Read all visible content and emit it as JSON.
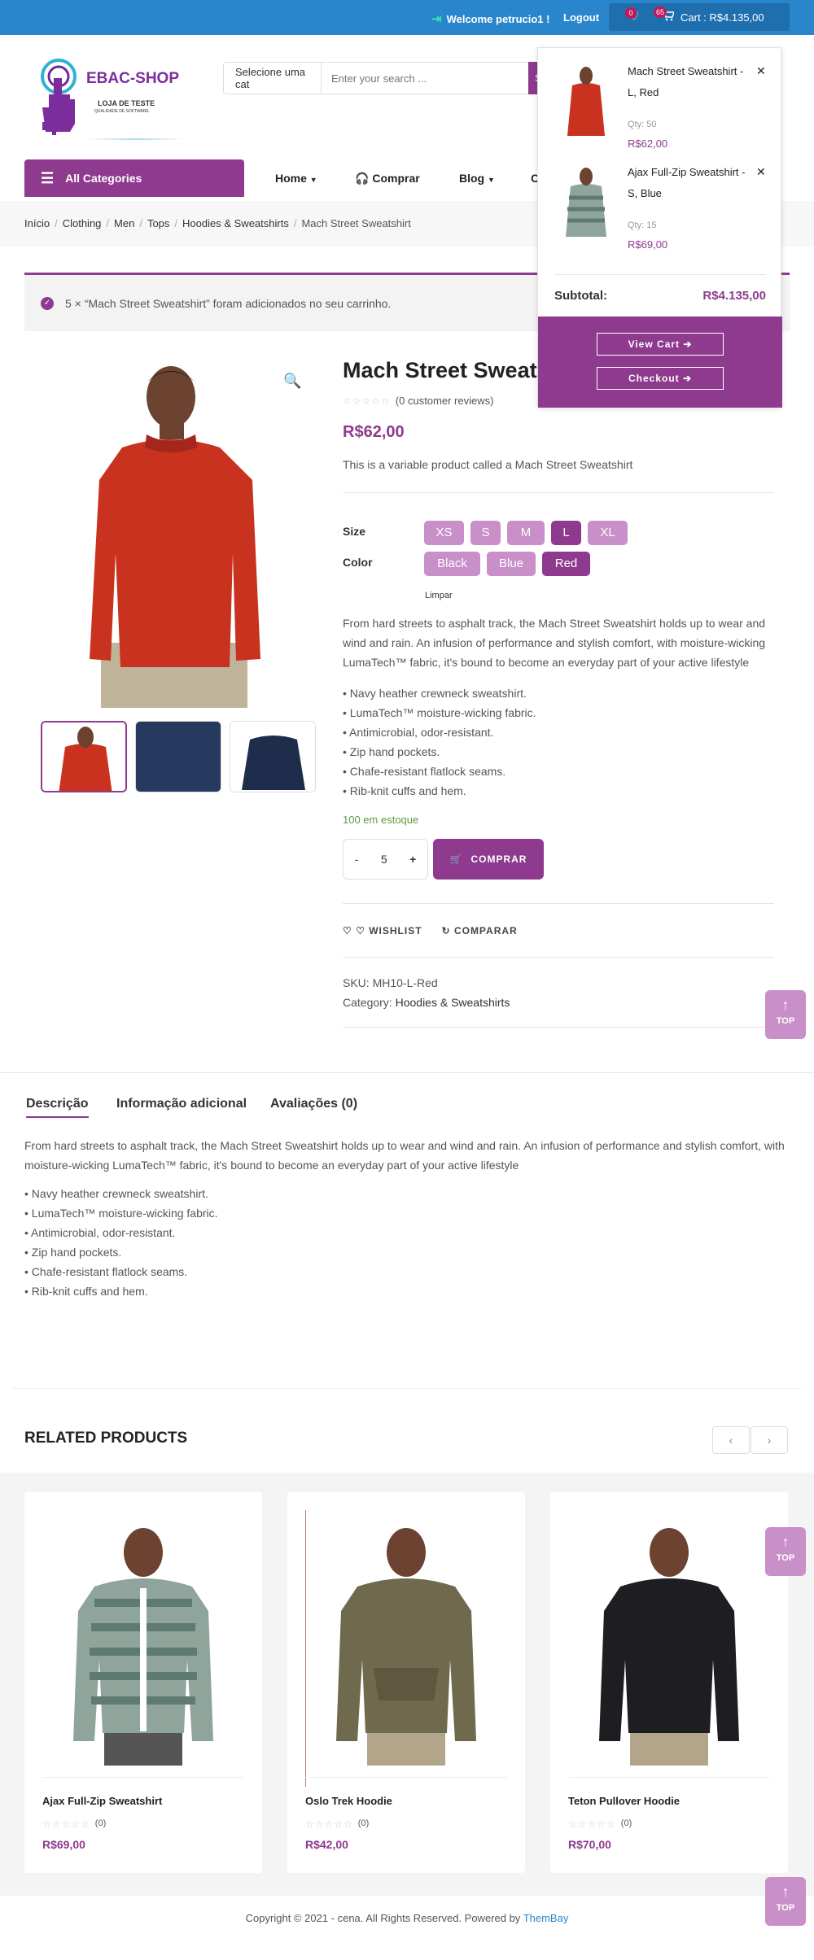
{
  "topbar": {
    "welcome": "Welcome petrucio1 !",
    "logout": "Logout",
    "wishlist_count": "0",
    "cart_count": "65",
    "cart_label": "Cart : R$4.135,00"
  },
  "header": {
    "brand": "EBAC-SHOP",
    "tagline": "LOJA DE TESTE",
    "tagline_small": "QUALIDADE DE SOFTWARE",
    "search_category": "Selecione uma cat",
    "search_placeholder": "Enter your search ...",
    "search_button": "S"
  },
  "nav": {
    "all_categories": "All Categories",
    "items": [
      "Home",
      "Comprar",
      "Blog",
      "C"
    ]
  },
  "breadcrumb": [
    "Início",
    "Clothing",
    "Men",
    "Tops",
    "Hoodies & Sweatshirts",
    "Mach Street Sweatshirt"
  ],
  "notice": "5 × “Mach Street Sweatshirt” foram adicionados no seu carrinho.",
  "product": {
    "title": "Mach Street Sweatsh",
    "reviews": "(0 customer reviews)",
    "price": "R$62,00",
    "short_description": "This is a variable product called a Mach Street Sweatshirt",
    "size_label": "Size",
    "sizes": [
      "XS",
      "S",
      "M",
      "L",
      "XL"
    ],
    "selected_size": "L",
    "color_label": "Color",
    "colors": [
      "Black",
      "Blue",
      "Red"
    ],
    "selected_color": "Red",
    "clear": "Limpar",
    "description": "From hard streets to asphalt track, the Mach Street Sweatshirt holds up to wear and wind and rain. An infusion of performance and stylish comfort, with moisture-wicking LumaTech™ fabric, it's bound to become an everyday part of your active lifestyle",
    "bullets": [
      "• Navy heather crewneck sweatshirt.",
      "• LumaTech™ moisture-wicking fabric.",
      "• Antimicrobial, odor-resistant.",
      "• Zip hand pockets.",
      "• Chafe-resistant flatlock seams.",
      "• Rib-knit cuffs and hem."
    ],
    "stock": "100 em estoque",
    "quantity": "5",
    "qty_minus": "-",
    "qty_plus": "+",
    "buy_label": "COMPRAR",
    "wishlist": "WISHLIST",
    "compare": "COMPARAR",
    "sku_label": "SKU:",
    "sku": "MH10-L-Red",
    "category_label": "Category:",
    "category": "Hoodies & Sweatshirts"
  },
  "tabs": [
    "Descrição",
    "Informação adicional",
    "Avaliações (0)"
  ],
  "tab_content": {
    "description": "From hard streets to asphalt track, the Mach Street Sweatshirt holds up to wear and wind and rain. An infusion of performance and stylish comfort, with moisture-wicking LumaTech™ fabric, it's bound to become an everyday part of your active lifestyle",
    "bullets": [
      "• Navy heather crewneck sweatshirt.",
      "• LumaTech™ moisture-wicking fabric.",
      "• Antimicrobial, odor-resistant.",
      "• Zip hand pockets.",
      "• Chafe-resistant flatlock seams.",
      "• Rib-knit cuffs and hem."
    ]
  },
  "related": {
    "title": "RELATED PRODUCTS",
    "products": [
      {
        "name": "Ajax Full-Zip Sweatshirt",
        "reviews": "(0)",
        "price": "R$69,00"
      },
      {
        "name": "Oslo Trek Hoodie",
        "reviews": "(0)",
        "price": "R$42,00"
      },
      {
        "name": "Teton Pullover Hoodie",
        "reviews": "(0)",
        "price": "R$70,00"
      }
    ]
  },
  "footer": {
    "text": "Copyright © 2021 - cena. All Rights Reserved. Powered by ",
    "link": "ThemBay"
  },
  "top_button": "TOP",
  "minicart": {
    "items": [
      {
        "name": "Mach Street Sweatshirt - L, Red",
        "qty": "Qty: 50",
        "price": "R$62,00"
      },
      {
        "name": "Ajax Full-Zip Sweatshirt - S, Blue",
        "qty": "Qty: 15",
        "price": "R$69,00"
      }
    ],
    "subtotal_label": "Subtotal:",
    "subtotal": "R$4.135,00",
    "view_cart": "View Cart ➔",
    "checkout": "Checkout ➔"
  },
  "colors": {
    "brand": "#8e3a8e",
    "swatch": "#c88fc8",
    "topbar": "#2a86cc",
    "stock": "#5a9a40"
  }
}
